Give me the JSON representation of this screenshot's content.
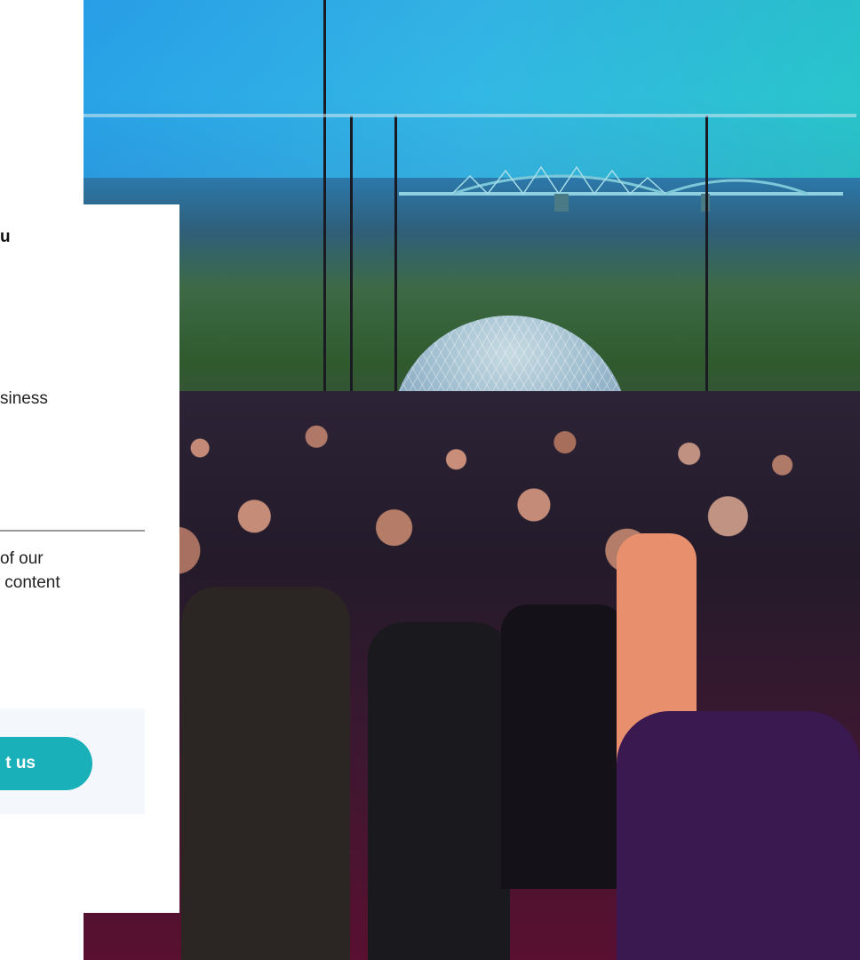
{
  "panel": {
    "heading": "u",
    "description_line": "siness",
    "body_lines": [
      "of our",
      " content"
    ],
    "cta_label": "t us"
  },
  "colors": {
    "cta": "#1ab0ba",
    "cta_box_bg": "#f4f7fb",
    "divider": "#9a9a9a"
  },
  "photo": {
    "alt": ""
  }
}
